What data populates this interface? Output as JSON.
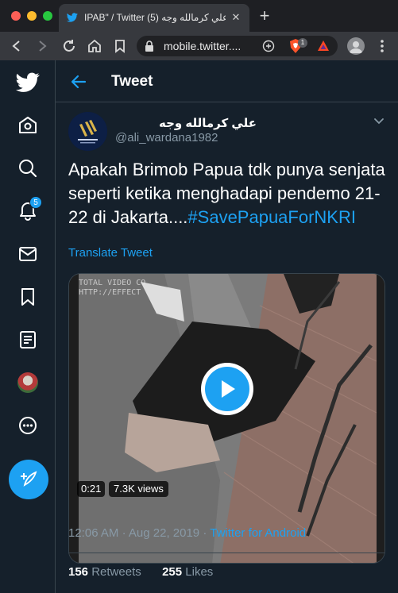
{
  "browser": {
    "tab_title": "‏IPAB\" / Twitter علي كرمالله وجه (5)",
    "url": "mobile.twitter....",
    "brave_shield_count": "1"
  },
  "sidebar": {
    "items": [
      {
        "icon": "home-icon"
      },
      {
        "icon": "search-icon"
      },
      {
        "icon": "notifications-icon",
        "badge": "5"
      },
      {
        "icon": "messages-icon"
      },
      {
        "icon": "bookmarks-icon"
      },
      {
        "icon": "lists-icon"
      },
      {
        "icon": "profile-avatar"
      },
      {
        "icon": "more-icon"
      }
    ],
    "compose_icon": "compose-tweet-icon"
  },
  "header": {
    "title": "Tweet"
  },
  "tweet": {
    "author_name": "علي كرمالله وجه",
    "author_handle": "@ali_wardana1982",
    "text": "Apakah Brimob Papua tdk punya senjata seperti ketika menghadapi pendemo 21-22 di Jakarta....",
    "hashtag": "#SavePapuaForNKRI",
    "translate_label": "Translate Tweet",
    "video": {
      "duration": "0:21",
      "views": "7.3K views",
      "watermark_line1": "TOTAL VIDEO CO",
      "watermark_line2": "HTTP://EFFECT"
    },
    "time": "12:06 AM",
    "date": "Aug 22, 2019",
    "separator": "·",
    "source": "Twitter for Android",
    "retweets_count": "156",
    "retweets_label": "Retweets",
    "likes_count": "255",
    "likes_label": "Likes"
  },
  "colors": {
    "background": "#15202b",
    "accent": "#1da1f2",
    "secondary_text": "#8899a6",
    "border": "#38444d"
  }
}
